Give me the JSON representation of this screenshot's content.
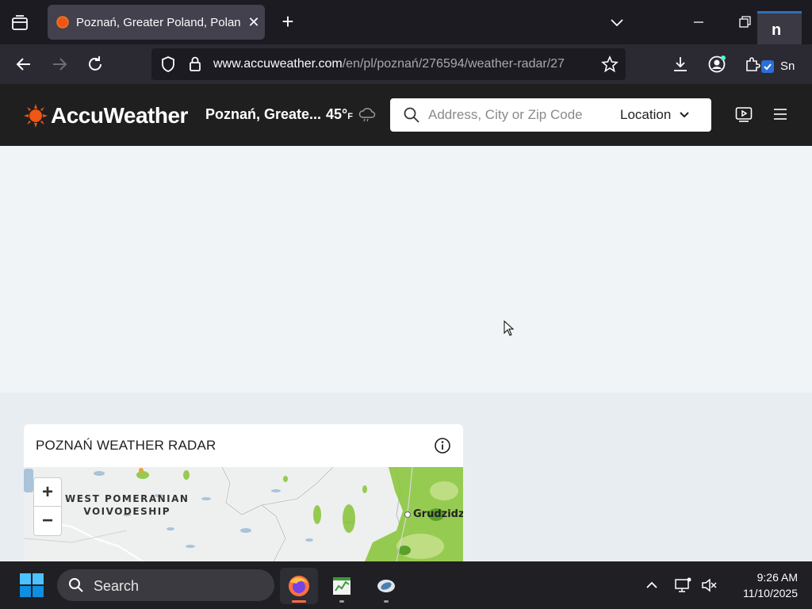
{
  "browser": {
    "tab": {
      "title": "Poznań, Greater Poland, Poland",
      "favicon": "accuweather-sun-icon"
    },
    "url": {
      "host": "www.accuweather.com",
      "path": "/en/pl/poznań/276594/weather-radar/27"
    },
    "extension_label": "n",
    "extension_badge": "Sn"
  },
  "header": {
    "brand": "AccuWeather",
    "location": "Poznań, Greate...",
    "temperature": "45°",
    "temperature_unit": "F",
    "search_placeholder": "Address, City or Zip Code",
    "location_button": "Location"
  },
  "radar": {
    "title": "POZNAŃ WEATHER RADAR",
    "zoom_in": "+",
    "zoom_out": "−",
    "region_label_line1": "WEST POMERANIAN",
    "region_label_line2": "VOIVODESHIP",
    "city_label": "Grudzidz"
  },
  "taskbar": {
    "search_label": "Search",
    "time": "9:26 AM",
    "date": "11/10/2025"
  },
  "colors": {
    "accent_orange": "#f05514",
    "header_bg": "#1f1f1f",
    "radar_green": "#8cc63f"
  }
}
